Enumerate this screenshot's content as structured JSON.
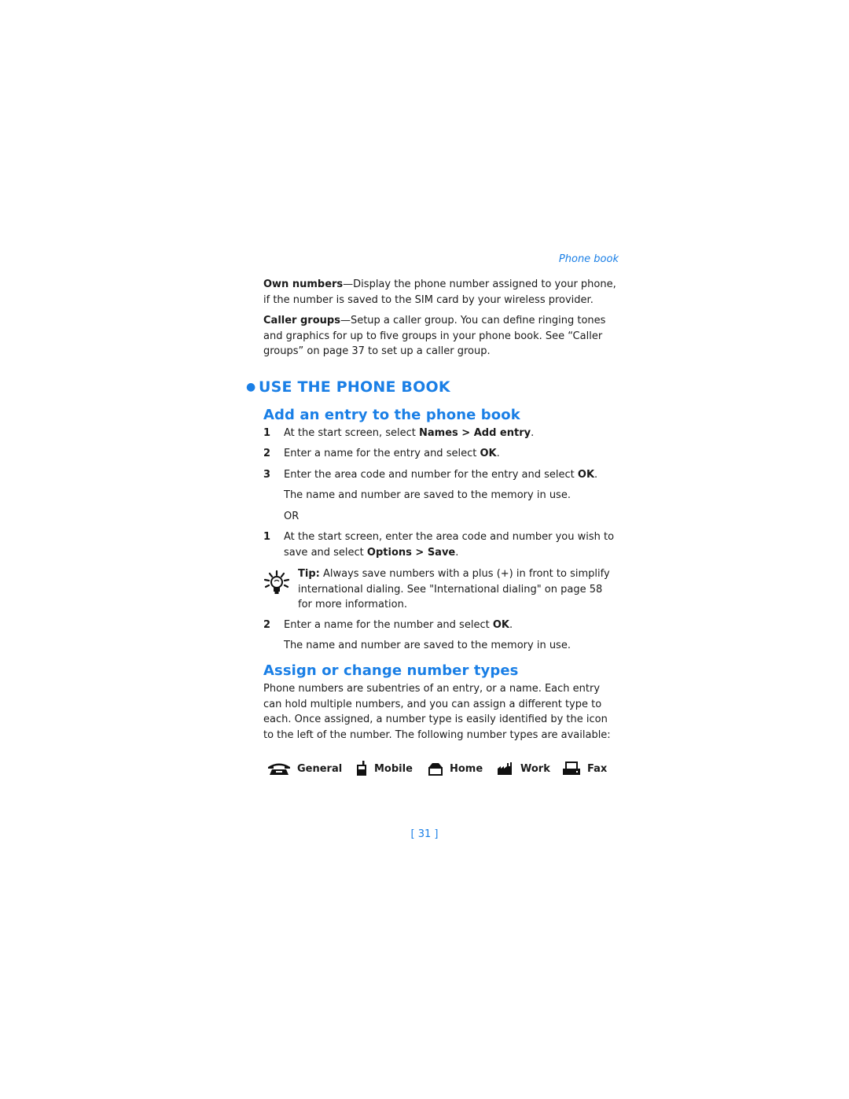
{
  "running_head": "Phone book",
  "own_numbers": {
    "term": "Own numbers",
    "text": "—Display the phone number assigned to your phone, if the number is saved to the SIM card by your wireless provider."
  },
  "caller_groups": {
    "term": "Caller groups",
    "text": "—Setup a caller group. You can define ringing tones and graphics for up to five groups in your phone book. See “Caller groups” on page 37 to set up a caller group."
  },
  "section_title": "USE THE PHONE BOOK",
  "add_entry": {
    "heading": "Add an entry to the phone book",
    "steps_a": [
      {
        "num": "1",
        "pre": "At the start screen, select ",
        "bold": "Names > Add entry",
        "post": "."
      },
      {
        "num": "2",
        "pre": "Enter a name for the entry and select ",
        "bold": "OK",
        "post": "."
      },
      {
        "num": "3",
        "pre": "Enter the area code and number for the entry and select ",
        "bold": "OK",
        "post": "."
      }
    ],
    "saved_note_a": "The name and number are saved to the memory in use.",
    "or_label": "OR",
    "steps_b": [
      {
        "num": "1",
        "pre": "At the start screen, enter the area code and number you wish to save and select ",
        "bold": "Options > Save",
        "post": "."
      },
      {
        "num": "2",
        "pre": "Enter a name for the number and select ",
        "bold": "OK",
        "post": "."
      }
    ],
    "tip": {
      "icon": "lightbulb-icon",
      "label": "Tip:",
      "text": " Always save numbers with a plus (+) in front to simplify international dialing. See \"International dialing\" on page 58 for more information."
    },
    "saved_note_b": "The name and number are saved to the memory in use."
  },
  "number_types": {
    "heading": "Assign or change number types",
    "body": "Phone numbers are subentries of an entry, or a name. Each entry can hold multiple numbers, and you can assign a different type to each. Once assigned, a number type is easily identified by the icon to the left of the number. The following number types are available:",
    "types": [
      {
        "icon": "telephone-icon",
        "label": "General"
      },
      {
        "icon": "mobile-phone-icon",
        "label": "Mobile"
      },
      {
        "icon": "home-icon",
        "label": "Home"
      },
      {
        "icon": "factory-icon",
        "label": "Work"
      },
      {
        "icon": "fax-icon",
        "label": "Fax"
      }
    ]
  },
  "page_number": "[ 31 ]",
  "colors": {
    "accent": "#1a7fe6",
    "text": "#1a1a1a"
  }
}
